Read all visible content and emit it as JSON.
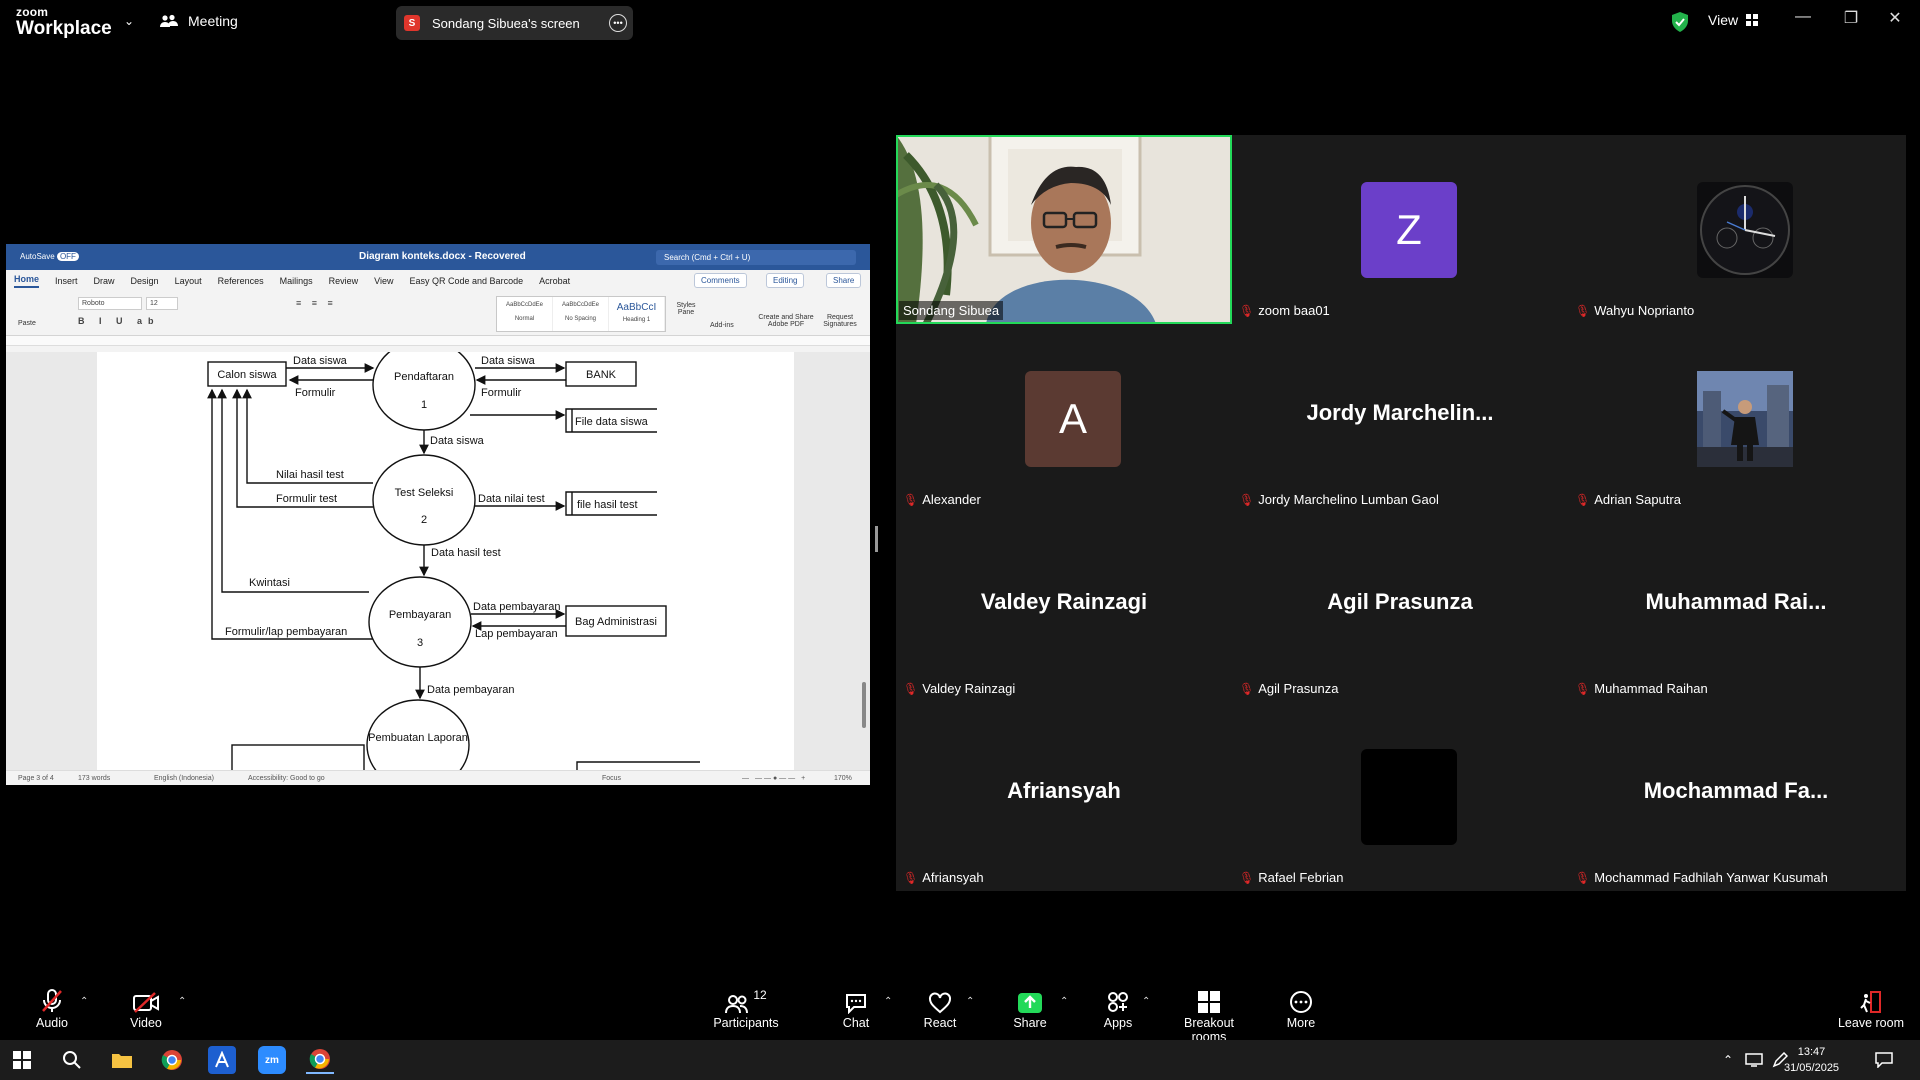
{
  "topbar": {
    "brand_line1": "zoom",
    "brand_line2": "Workplace",
    "meeting_label": "Meeting",
    "share_initial": "S",
    "share_label": "Sondang Sibuea's screen",
    "view_label": "View"
  },
  "word": {
    "autosave": "AutoSave",
    "autosave_state": "OFF",
    "doc_title": "Diagram konteks.docx  -  Recovered",
    "search_placeholder": "Search (Cmd + Ctrl + U)",
    "tabs": [
      "Home",
      "Insert",
      "Draw",
      "Design",
      "Layout",
      "References",
      "Mailings",
      "Review",
      "View",
      "Easy QR Code and Barcode",
      "Acrobat"
    ],
    "comments_label": "Comments",
    "editing_label": "Editing",
    "share_label": "Share",
    "font_name": "Roboto",
    "font_size": "12",
    "styles": [
      "AaBbCcDdEe",
      "AaBbCcDdEe",
      "AaBbCcI"
    ],
    "style_names": [
      "Normal",
      "No Spacing",
      "Heading 1"
    ],
    "ribbon_labels": [
      "Paste",
      "Styles Pane",
      "Add-ins",
      "Create and Share Adobe PDF",
      "Request Signatures"
    ],
    "status": {
      "page": "Page 3 of 4",
      "words": "173 words",
      "language": "English (Indonesia)",
      "accessibility": "Accessibility: Good to go",
      "focus": "Focus",
      "zoom": "170%"
    },
    "diagram": {
      "entities": [
        "Calon siswa",
        "BANK",
        "File data siswa",
        "file hasil test",
        "Bag Administrasi"
      ],
      "processes": [
        {
          "name": "Pendaftaran",
          "num": "1"
        },
        {
          "name": "Test Seleksi",
          "num": "2"
        },
        {
          "name": "Pembayaran",
          "num": "3"
        },
        {
          "name": "Pembuatan Laporan",
          "num": ""
        }
      ],
      "flows": [
        "Data siswa",
        "Formulir",
        "Data siswa",
        "Formulir",
        "Data siswa",
        "Nilai hasil test",
        "Formulir test",
        "Data nilai test",
        "Data hasil test",
        "Kwintasi",
        "Data pembayaran",
        "Lap pembayaran",
        "Formulir/lap pembayaran",
        "Data pembayaran"
      ]
    }
  },
  "gallery": {
    "tiles": [
      {
        "name": "Sondang Sibuea",
        "display": "",
        "avatar_letter": "",
        "type": "video"
      },
      {
        "name": "zoom baa01",
        "display": "",
        "avatar_letter": "Z",
        "type": "avatar",
        "color": "#6b3fc9"
      },
      {
        "name": "Wahyu Noprianto",
        "display": "",
        "avatar_letter": "",
        "type": "watch"
      },
      {
        "name": "Alexander",
        "display": "",
        "avatar_letter": "A",
        "type": "avatar",
        "color": "#5b3a32"
      },
      {
        "name": "Jordy Marchelino Lumban Gaol",
        "display": "Jordy  Marchelin...",
        "type": "text"
      },
      {
        "name": "Adrian Saputra",
        "display": "",
        "type": "photo"
      },
      {
        "name": "Valdey Rainzagi",
        "display": "Valdey Rainzagi",
        "type": "text"
      },
      {
        "name": "Agil Prasunza",
        "display": "Agil Prasunza",
        "type": "text"
      },
      {
        "name": "Muhammad Raihan",
        "display": "Muhammad  Rai...",
        "type": "text"
      },
      {
        "name": "Afriansyah",
        "display": "Afriansyah",
        "type": "text"
      },
      {
        "name": "Rafael Febrian",
        "display": "",
        "type": "black"
      },
      {
        "name": "Mochammad Fadhilah Yanwar Kusumah",
        "display": "Mochammad  Fa...",
        "type": "text"
      }
    ]
  },
  "toolbar": {
    "audio": "Audio",
    "video": "Video",
    "participants": "Participants",
    "participants_count": "12",
    "chat": "Chat",
    "react": "React",
    "share": "Share",
    "apps": "Apps",
    "breakout": "Breakout rooms",
    "more": "More",
    "leave": "Leave room"
  },
  "taskbar": {
    "time": "13:47",
    "date": "31/05/2025"
  },
  "colors": {
    "word_blue": "#2b579a",
    "active_speaker": "#23d959",
    "muted_red": "#e02828",
    "share_green": "#23d959"
  }
}
